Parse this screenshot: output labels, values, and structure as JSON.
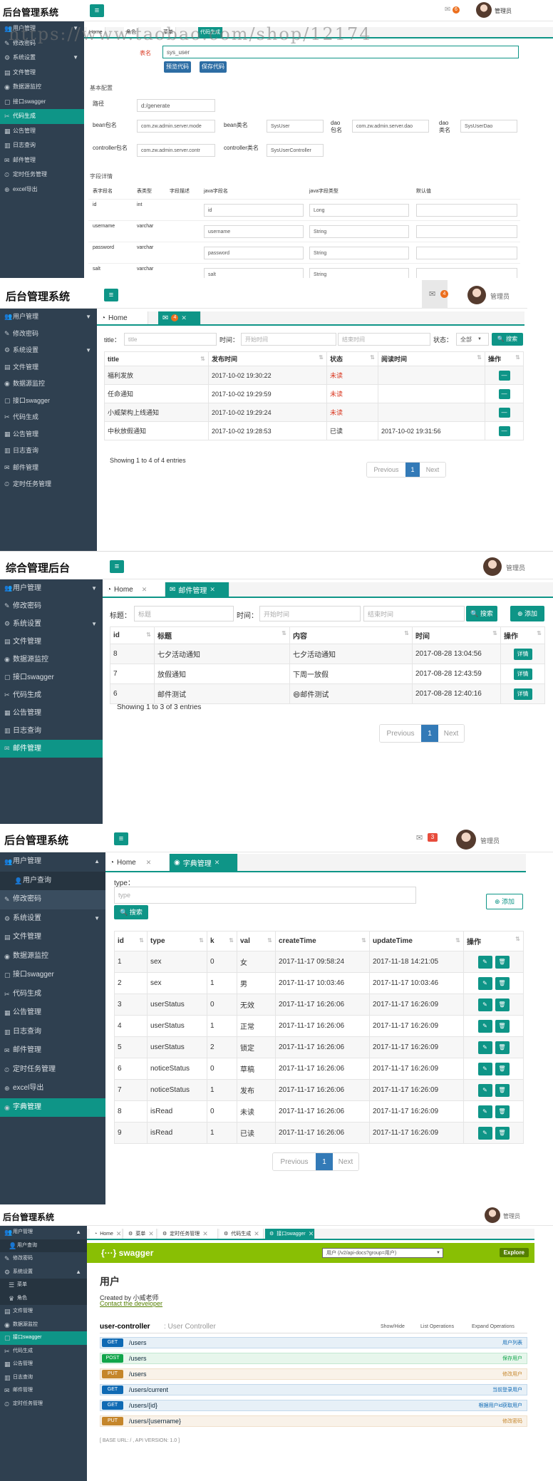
{
  "p1": {
    "brand": "后台管理系统",
    "badge": "6",
    "user": "管理员",
    "watermark": "https://www.taobao.com/shop/12174",
    "tabs": [
      "Home",
      "角色",
      "菜单",
      "代码生成"
    ],
    "sidebar": [
      "用户管理",
      "修改密码",
      "系统设置",
      "文件管理",
      "数据源监控",
      "接口swagger",
      "代码生成",
      "公告管理",
      "日志查询",
      "邮件管理",
      "定时任务管理",
      "excel导出"
    ],
    "table_name_label": "表名",
    "table_name_value": "sys_user",
    "preview_btn": "预览代码",
    "save_btn": "保存代码",
    "basic_config": "基本配置",
    "path_label": "路径",
    "path_value": "d:/generate",
    "bean_pkg_label": "bean包名",
    "bean_pkg_value": "com.zw.admin.server.mode",
    "bean_cls_label": "bean类名",
    "bean_cls_value": "SysUser",
    "dao_pkg_label": "dao包名",
    "dao_pkg_value": "com.zw.admin.server.dao",
    "dao_cls_label": "dao类名",
    "dao_cls_value": "SysUserDao",
    "ctrl_pkg_label": "controller包名",
    "ctrl_pkg_value": "com.zw.admin.server.contr",
    "ctrl_cls_label": "controller类名",
    "ctrl_cls_value": "SysUserController",
    "field_detail": "字段详情",
    "field_headers": [
      "表字段名",
      "表类型",
      "字段描述",
      "java字段名",
      "java字段类型",
      "默认值"
    ],
    "fields": [
      {
        "col": "id",
        "type": "int",
        "jname": "id",
        "jtype": "Long"
      },
      {
        "col": "username",
        "type": "varchar",
        "jname": "username",
        "jtype": "String"
      },
      {
        "col": "password",
        "type": "varchar",
        "jname": "password",
        "jtype": "String"
      },
      {
        "col": "salt",
        "type": "varchar",
        "jname": "salt",
        "jtype": "String"
      }
    ]
  },
  "p2": {
    "brand": "后台管理系统",
    "badge": "4",
    "user": "管理员",
    "tab_home": "Home",
    "tab_badge": "4",
    "sidebar": [
      "用户管理",
      "修改密码",
      "系统设置",
      "文件管理",
      "数据源监控",
      "接口swagger",
      "代码生成",
      "公告管理",
      "日志查询",
      "邮件管理",
      "定时任务管理"
    ],
    "title_label": "title：",
    "title_ph": "title",
    "time_label": "时间：",
    "start_ph": "开始时间",
    "end_ph": "结束时间",
    "status_label": "状态：",
    "status_value": "全部",
    "search_btn": "搜索",
    "headers": [
      "title",
      "发布时间",
      "状态",
      "阅读时间",
      "操作"
    ],
    "rows": [
      [
        "福利发放",
        "2017-10-02 19:30:22",
        "未读",
        ""
      ],
      [
        "任命通知",
        "2017-10-02 19:29:59",
        "未读",
        ""
      ],
      [
        "小威架构上线通知",
        "2017-10-02 19:29:24",
        "未读",
        ""
      ],
      [
        "中秋放假通知",
        "2017-10-02 19:28:53",
        "已读",
        "2017-10-02 19:31:56"
      ]
    ],
    "info": "Showing 1 to 4 of 4 entries",
    "prev": "Previous",
    "page": "1",
    "next": "Next"
  },
  "p3": {
    "brand": "综合管理后台",
    "user": "管理员",
    "tab_home": "Home",
    "tab_mail": "邮件管理",
    "sidebar": [
      "用户管理",
      "修改密码",
      "系统设置",
      "文件管理",
      "数据源监控",
      "接口swagger",
      "代码生成",
      "公告管理",
      "日志查询",
      "邮件管理"
    ],
    "title_label": "标题：",
    "title_ph": "标题",
    "time_label": "时间：",
    "start_ph": "开始时间",
    "end_ph": "结束时间",
    "search_btn": "搜索",
    "add_btn": "添加",
    "headers": [
      "id",
      "标题",
      "内容",
      "时间",
      "操作"
    ],
    "rows": [
      [
        "8",
        "七夕活动通知",
        "七夕活动通知",
        "2017-08-28 13:04:56"
      ],
      [
        "7",
        "放假通知",
        "下周一放假",
        "2017-08-28 12:43:59"
      ],
      [
        "6",
        "邮件测试",
        "😄邮件测试",
        "2017-08-28 12:40:16"
      ]
    ],
    "detail_btn": "详情",
    "info": "Showing 1 to 3 of 3 entries",
    "prev": "Previous",
    "page": "1",
    "next": "Next"
  },
  "p4": {
    "brand": "后台管理系统",
    "badge": "3",
    "user": "管理员",
    "tab_home": "Home",
    "tab_dict": "字典管理",
    "sidebar": [
      "用户管理",
      "用户查询",
      "修改密码",
      "系统设置",
      "文件管理",
      "数据源监控",
      "接口swagger",
      "代码生成",
      "公告管理",
      "日志查询",
      "邮件管理",
      "定时任务管理",
      "excel导出",
      "字典管理"
    ],
    "type_label": "type：",
    "type_ph": "type",
    "search_btn": "搜索",
    "add_btn": "添加",
    "headers": [
      "id",
      "type",
      "k",
      "val",
      "createTime",
      "updateTime",
      "操作"
    ],
    "rows": [
      [
        "1",
        "sex",
        "0",
        "女",
        "2017-11-17 09:58:24",
        "2017-11-18 14:21:05"
      ],
      [
        "2",
        "sex",
        "1",
        "男",
        "2017-11-17 10:03:46",
        "2017-11-17 10:03:46"
      ],
      [
        "3",
        "userStatus",
        "0",
        "无效",
        "2017-11-17 16:26:06",
        "2017-11-17 16:26:09"
      ],
      [
        "4",
        "userStatus",
        "1",
        "正常",
        "2017-11-17 16:26:06",
        "2017-11-17 16:26:09"
      ],
      [
        "5",
        "userStatus",
        "2",
        "锁定",
        "2017-11-17 16:26:06",
        "2017-11-17 16:26:09"
      ],
      [
        "6",
        "noticeStatus",
        "0",
        "草稿",
        "2017-11-17 16:26:06",
        "2017-11-17 16:26:09"
      ],
      [
        "7",
        "noticeStatus",
        "1",
        "发布",
        "2017-11-17 16:26:06",
        "2017-11-17 16:26:09"
      ],
      [
        "8",
        "isRead",
        "0",
        "未读",
        "2017-11-17 16:26:06",
        "2017-11-17 16:26:09"
      ],
      [
        "9",
        "isRead",
        "1",
        "已读",
        "2017-11-17 16:26:06",
        "2017-11-17 16:26:09"
      ]
    ],
    "prev": "Previous",
    "page": "1",
    "next": "Next"
  },
  "p5": {
    "brand": "后台管理系统",
    "user": "管理员",
    "tabs": [
      "Home",
      "菜单",
      "定时任务管理",
      "代码生成",
      "接口swagger"
    ],
    "sidebar": [
      "用户管理",
      "用户查询",
      "修改密码",
      "系统设置",
      "菜单",
      "角色",
      "文件管理",
      "数据源监控",
      "接口swagger",
      "代码生成",
      "公告管理",
      "日志查询",
      "邮件管理",
      "定时任务管理"
    ],
    "swagger_logo": "swagger",
    "api_select": "用户 (/v2/api-docs?group=用户)",
    "explore": "Explore",
    "api_title": "用户",
    "created_by": "Created by 小威老师",
    "contact": "Contact the developer",
    "controller": "user-controller",
    "controller_desc": ": User Controller",
    "show_hide": "Show/Hide",
    "list_ops": "List Operations",
    "expand_ops": "Expand Operations",
    "ops": [
      {
        "method": "GET",
        "path": "/users",
        "summary": "用户列表",
        "color": "#0f6ab4"
      },
      {
        "method": "POST",
        "path": "/users",
        "summary": "保存用户",
        "color": "#10a54a"
      },
      {
        "method": "PUT",
        "path": "/users",
        "summary": "修改用户",
        "color": "#c5862b"
      },
      {
        "method": "GET",
        "path": "/users/current",
        "summary": "当前登录用户",
        "color": "#0f6ab4"
      },
      {
        "method": "GET",
        "path": "/users/{id}",
        "summary": "根据用户id获取用户",
        "color": "#0f6ab4"
      },
      {
        "method": "PUT",
        "path": "/users/{username}",
        "summary": "修改密码",
        "color": "#c5862b"
      }
    ],
    "base_url": "[ BASE URL: / , API VERSION: 1.0 ]"
  },
  "colors": {
    "accent": "#0e9587",
    "sidebar": "#2f4050",
    "swagger": "#89bf04",
    "badge": "#ec6f1e"
  }
}
